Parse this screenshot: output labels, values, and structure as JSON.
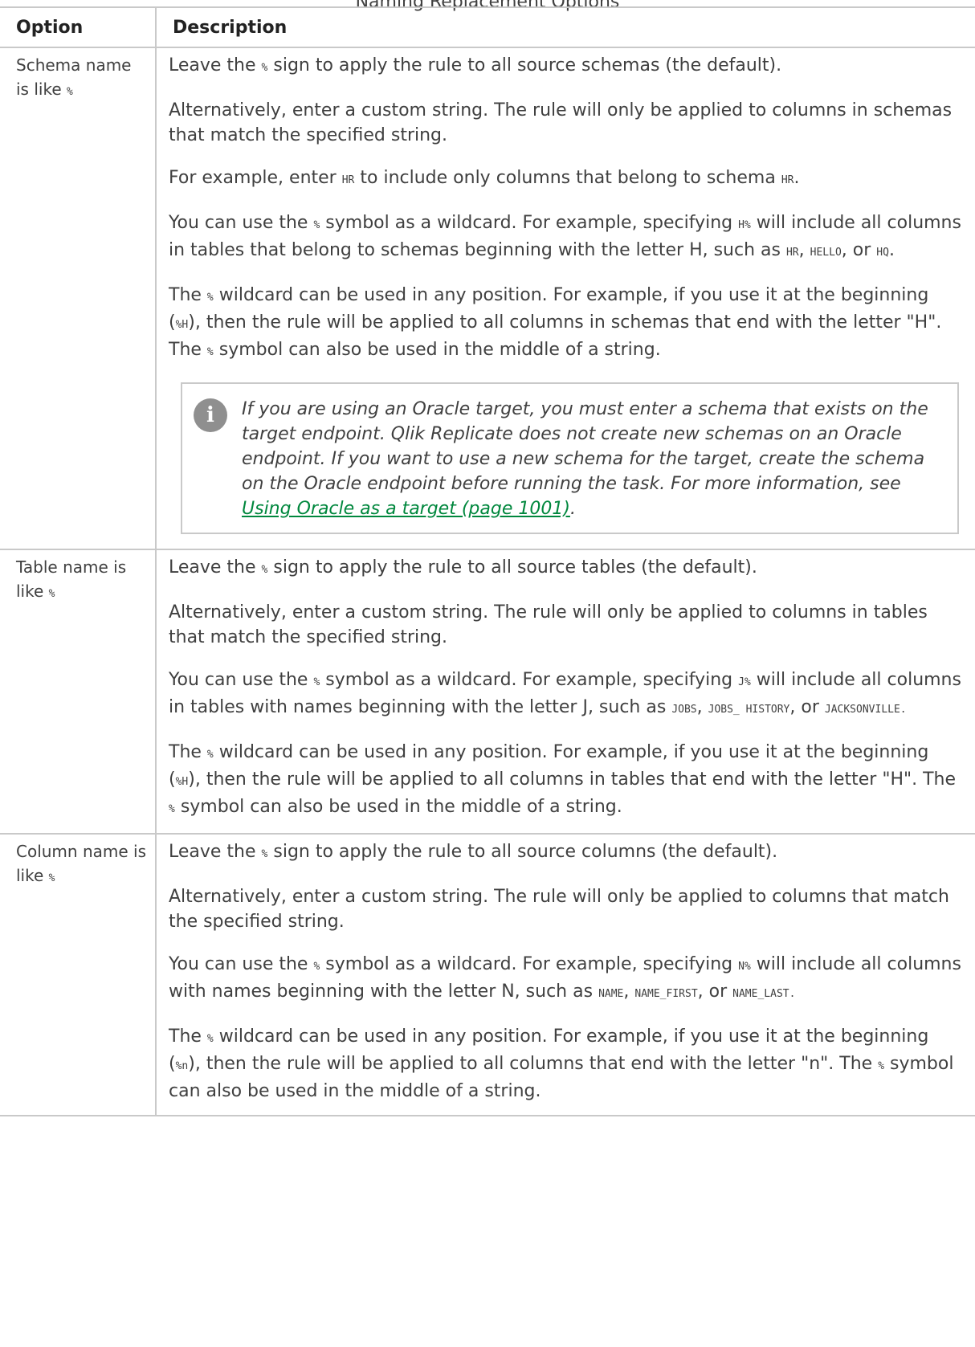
{
  "caption": "Naming Replacement Options",
  "headers": {
    "option": "Option",
    "description": "Description"
  },
  "schema": {
    "label": "Schema name is like",
    "wildcard": "%",
    "p1": {
      "a": "Leave the",
      "code": "%",
      "b": "sign to apply the rule to all source schemas (the default)."
    },
    "p2": "Alternatively, enter a custom string. The rule will only be applied to columns in schemas that match the specified string.",
    "p3": {
      "a": "For example, enter",
      "code1": "HR",
      "b": "to include only columns that belong to schema",
      "code2": "HR",
      "c": "."
    },
    "p4": {
      "a": "You can use the",
      "code1": "%",
      "b": "symbol as a wildcard. For example, specifying",
      "code2": "H%",
      "c": "will include all columns in tables that belong to schemas beginning with the letter H, such as",
      "code3": "HR",
      "d": ",",
      "code4": "HELLO",
      "e": ", or",
      "code5": "HQ",
      "f": "."
    },
    "p5": {
      "a": "The",
      "code1": "%",
      "b": "wildcard can be used in any position. For example, if you use it at the beginning (",
      "code2": "%H",
      "c": "), then the rule will be applied to all columns in schemas that end with the letter \"H\". The",
      "code3": "%",
      "d": "symbol can also be used in the middle of a string."
    },
    "note": {
      "icon": "i",
      "text": "If you are using an Oracle target, you must enter a schema that exists on the target endpoint. Qlik Replicate does not create new schemas on an Oracle endpoint. If you want to use a new schema for the target, create the schema on the Oracle endpoint before running the task. For more information, see",
      "link": "Using Oracle as a target (page 1001)",
      "end": "."
    }
  },
  "table": {
    "label": "Table name is like",
    "wildcard": "%",
    "p1": {
      "a": "Leave the",
      "code": "%",
      "b": "sign to apply the rule to all source tables (the default)."
    },
    "p2": "Alternatively, enter a custom string. The rule will only be applied to columns in tables that match the specified string.",
    "p3": {
      "a": "You can use the",
      "code1": "%",
      "b": "symbol as a wildcard. For example, specifying",
      "code2": "J%",
      "c": "will include all columns in tables with names beginning with the letter J, such as",
      "code3": "JOBS",
      "d": ",",
      "code4": "JOBS_ HISTORY",
      "e": ", or",
      "code5": "JACKSONVILLE.",
      "f": ""
    },
    "p4": {
      "a": "The",
      "code1": "%",
      "b": "wildcard can be used in any position. For example, if you use it at the beginning (",
      "code2": "%H",
      "c": "), then the rule will be applied to all columns in tables that end with the letter \"H\". The",
      "code3": "%",
      "d": "symbol can also be used in the middle of a string."
    }
  },
  "column": {
    "label": "Column name is like",
    "wildcard": "%",
    "p1": {
      "a": "Leave the",
      "code": "%",
      "b": "sign to apply the rule to all source columns (the default)."
    },
    "p2": "Alternatively, enter a custom string. The rule will only be applied to columns that match the specified string.",
    "p3": {
      "a": "You can use the",
      "code1": "%",
      "b": "symbol as a wildcard. For example, specifying",
      "code2": "N%",
      "c": "will include all columns with names beginning with the letter N, such as",
      "code3": "NAME",
      "d": ",",
      "code4": "NAME_FIRST",
      "e": ", or",
      "code5": "NAME_LAST.",
      "f": ""
    },
    "p4": {
      "a": "The",
      "code1": "%",
      "b": "wildcard can be used in any position. For example, if you use it at the beginning (",
      "code2": "%n",
      "c": "), then the rule will be applied to all columns that end with the letter \"n\". The",
      "code3": "%",
      "d": "symbol can also be used in the middle of a string."
    }
  }
}
